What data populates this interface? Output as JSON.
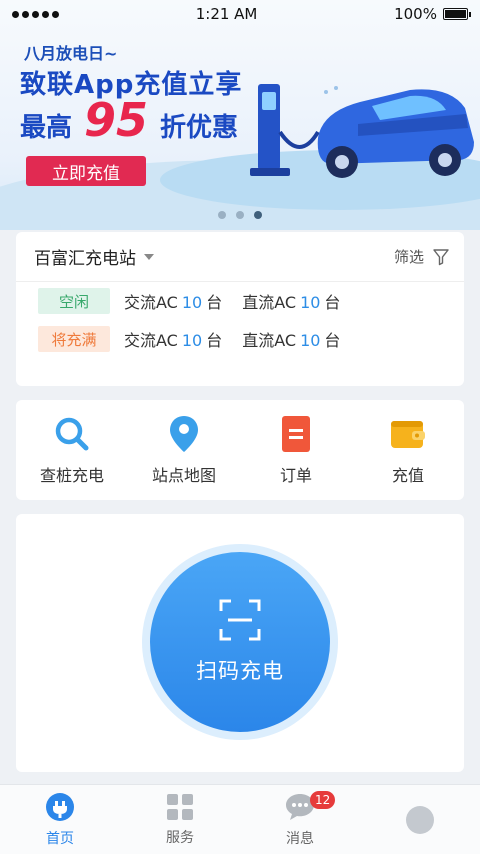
{
  "status_bar": {
    "time": "1:21 AM",
    "battery": "100%"
  },
  "banner": {
    "small_title": "八月放电日~",
    "line1": "致联App充值立享",
    "line2_prefix": "最高",
    "line2_number": "95",
    "line2_suffix": "折优惠",
    "cta_label": "立即充值",
    "page_count": 3,
    "active_page": 3
  },
  "station": {
    "name": "百富汇充电站",
    "filter_label": "筛选",
    "rows": [
      {
        "status": "空闲",
        "ac_prefix": "交流AC",
        "ac_count": "10",
        "ac_unit": "台",
        "dc_prefix": "直流AC",
        "dc_count": "10",
        "dc_unit": "台"
      },
      {
        "status": "将充满",
        "ac_prefix": "交流AC",
        "ac_count": "10",
        "ac_unit": "台",
        "dc_prefix": "直流AC",
        "dc_count": "10",
        "dc_unit": "台"
      }
    ]
  },
  "quick_actions": [
    {
      "label": "查桩充电",
      "icon": "search-icon"
    },
    {
      "label": "站点地图",
      "icon": "location-pin-icon"
    },
    {
      "label": "订单",
      "icon": "order-icon"
    },
    {
      "label": "充值",
      "icon": "wallet-icon"
    }
  ],
  "scan": {
    "label": "扫码充电"
  },
  "tabs": [
    {
      "label": "首页",
      "icon": "home-plug-icon"
    },
    {
      "label": "服务",
      "icon": "grid-icon"
    },
    {
      "label": "消息",
      "icon": "chat-icon",
      "badge": "12"
    }
  ],
  "colors": {
    "accent": "#2b86e9",
    "cta": "#e12a52",
    "idle": "#37a86b",
    "nearly_full": "#ef7a3b"
  }
}
